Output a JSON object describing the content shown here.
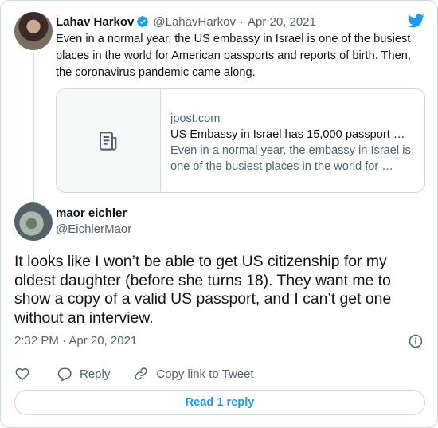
{
  "colors": {
    "accent": "#1d9bf0",
    "secondary_text": "#536471",
    "border": "#cfd9de"
  },
  "parent_tweet": {
    "name": "Lahav Harkov",
    "handle": "@LahavHarkov",
    "separator": "·",
    "date": "Apr 20, 2021",
    "text": "Even in a normal year, the US embassy in Israel is one of the busiest places in the world for American passports and reports of birth. Then, the coronavirus pandemic came along.",
    "link_card": {
      "domain": "jpost.com",
      "title": "US Embassy in Israel has 15,000 passport …",
      "description": "Even in a normal year, the embassy in Israel is one of the busiest places in the world for …",
      "thumbnail_icon": "article-icon"
    }
  },
  "main_tweet": {
    "name": "maor eichler",
    "handle": "@EichlerMaor",
    "text": "It looks like I won’t be able to get US citizenship for my oldest daughter (before she turns 18). They want me to show a copy of a valid US passport, and I can’t get one without an interview.",
    "timestamp": "2:32 PM · Apr 20, 2021"
  },
  "actions": {
    "like_icon": "heart-icon",
    "reply_label": "Reply",
    "copy_label": "Copy link to Tweet"
  },
  "read_replies_label": "Read 1 reply"
}
